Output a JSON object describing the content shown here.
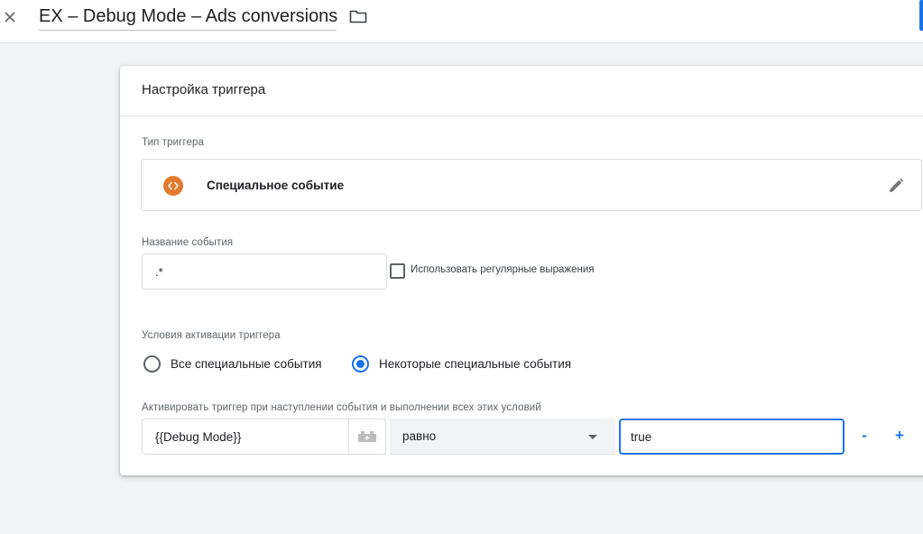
{
  "header": {
    "title": "EX – Debug Mode – Ads conversions",
    "close_icon": "close-icon",
    "folder_icon": "folder-icon"
  },
  "card": {
    "title": "Настройка триггера",
    "trigger_type": {
      "label": "Тип триггера",
      "name": "Специальное событие",
      "icon": "code-brackets-icon",
      "icon_color": "#e37a2e"
    },
    "event_name": {
      "label": "Название события",
      "value": ".*",
      "regex_label": "Использовать регулярные выражения",
      "regex_checked": false
    },
    "fire_conditions": {
      "label": "Условия активации триггера",
      "option_all": "Все специальные события",
      "option_some": "Некоторые специальные события",
      "selected": "option_some"
    },
    "conditions": {
      "label": "Активировать триггер при наступлении события и выполнении всех этих условий",
      "variable": "{{Debug Mode}}",
      "operator": "равно",
      "value": "true",
      "remove_label": "-",
      "add_label": "+"
    }
  },
  "colors": {
    "accent": "#1a73e8",
    "background": "#f1f3f4",
    "trigger_icon": "#e37a2e"
  }
}
